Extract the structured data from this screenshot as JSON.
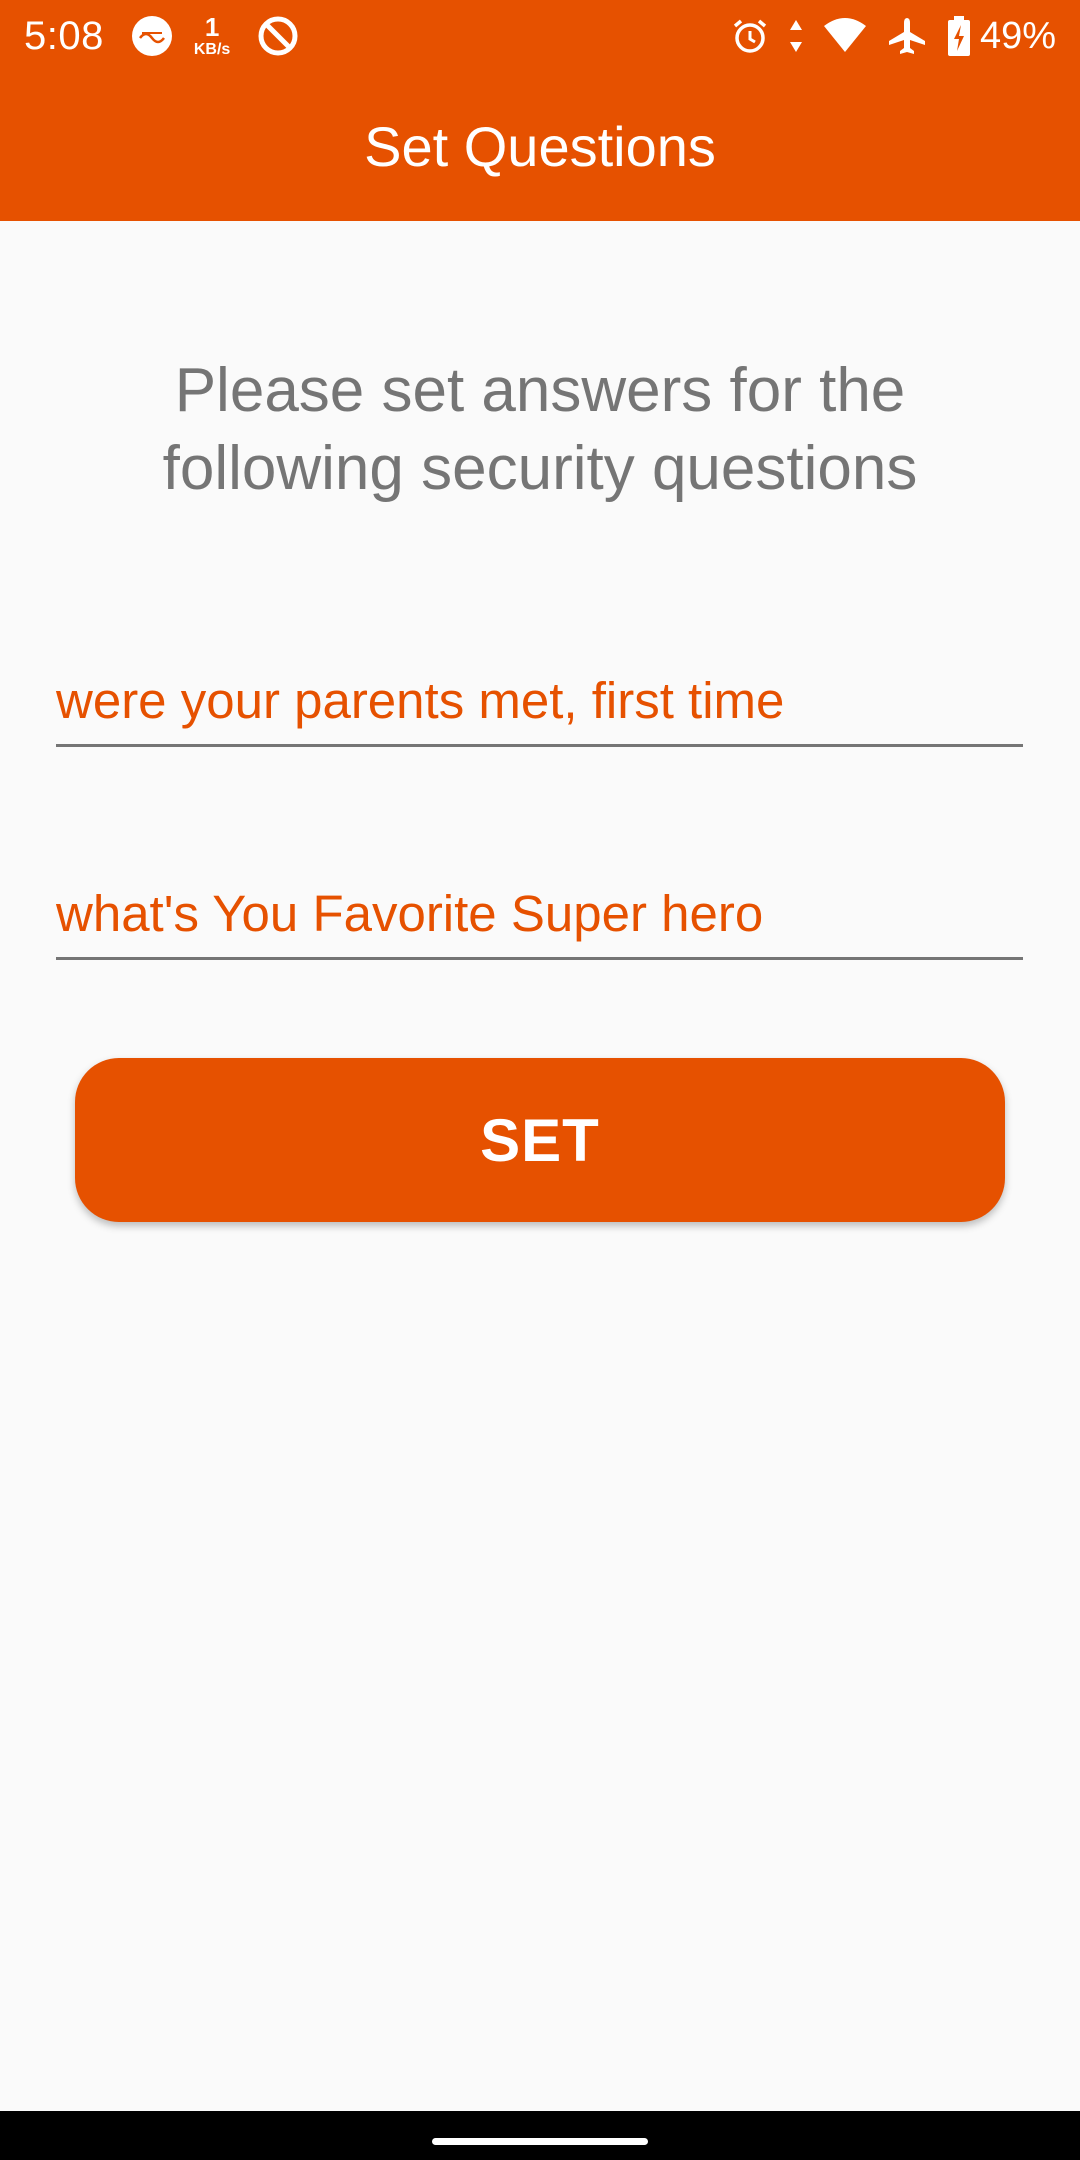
{
  "status_bar": {
    "time": "5:08",
    "net_speed_value": "1",
    "net_speed_unit": "KB/s",
    "battery": "49%",
    "icons": [
      "notification-icon",
      "network-speed-indicator",
      "vpn-icon",
      "alarm-icon",
      "data-arrows-icon",
      "wifi-icon",
      "airplane-icon",
      "battery-charging-icon"
    ]
  },
  "app_bar": {
    "title": "Set Questions"
  },
  "form": {
    "instruction": "Please set answers for the following security questions",
    "question1": "were your parents met, first time",
    "question2": "what's You Favorite Super hero",
    "submit_label": "SET"
  },
  "colors": {
    "primary": "#e65100",
    "hint_text": "#757575",
    "background": "#fafafa"
  }
}
